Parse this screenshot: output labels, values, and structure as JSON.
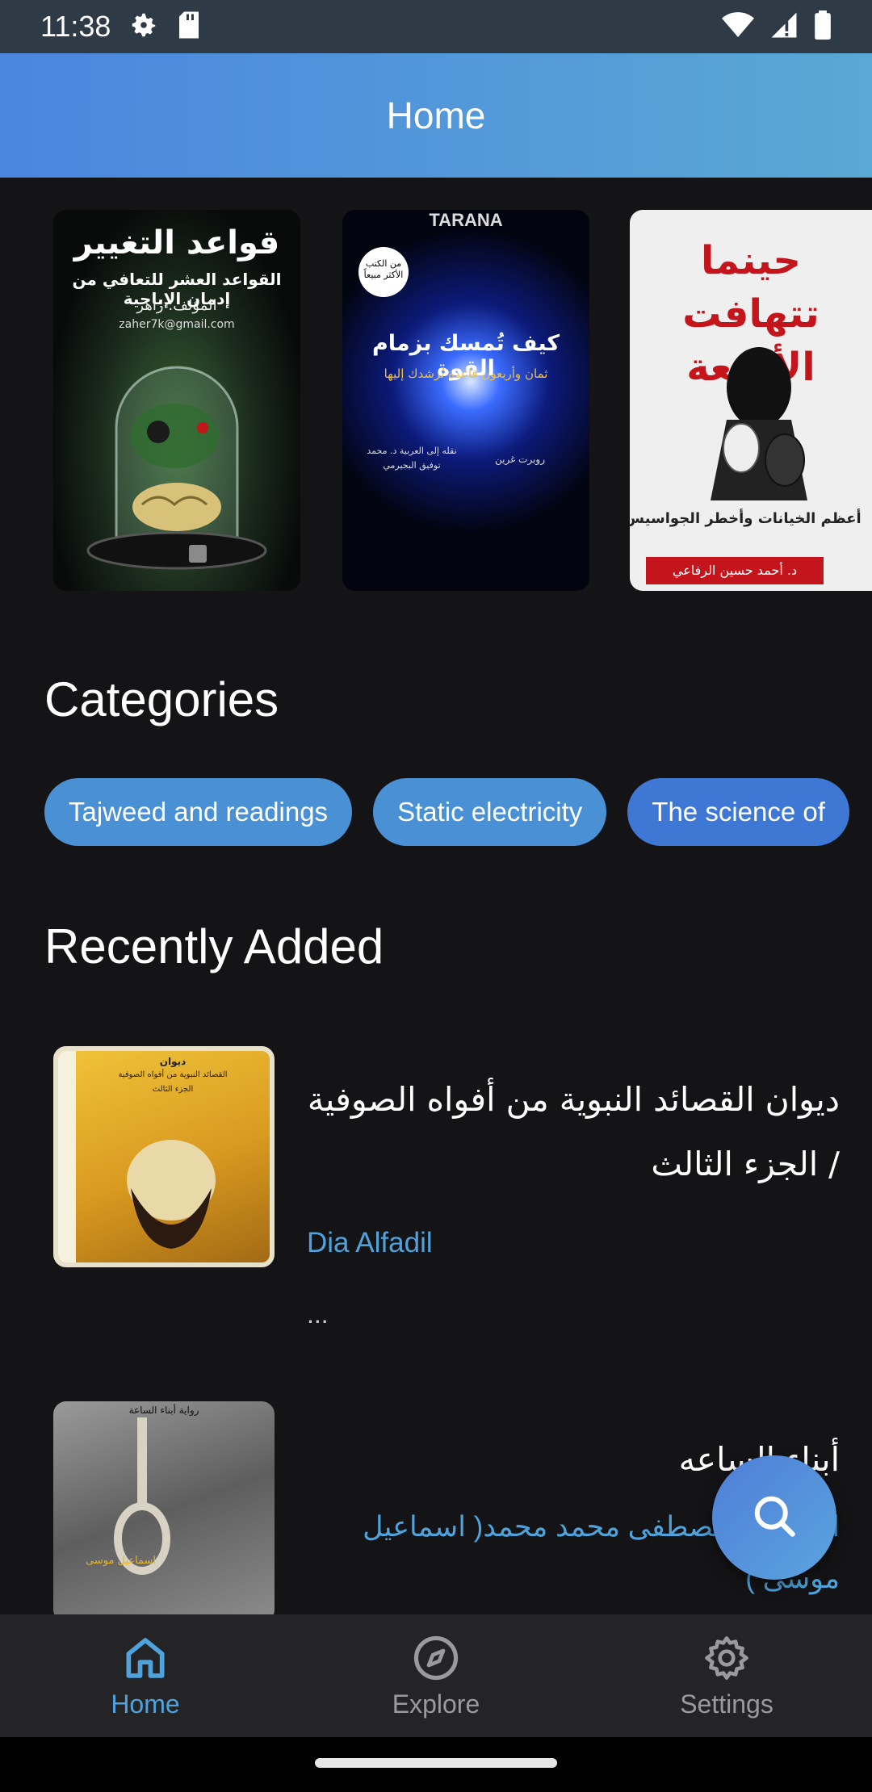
{
  "status_bar": {
    "time": "11:38"
  },
  "app_bar": {
    "title": "Home"
  },
  "featured": {
    "books": [
      {
        "title": "قواعد التغيير",
        "subtitle": "القواعد العشر للتعافي من إدمان الإباحية",
        "author_line": "المؤلف: زاهر",
        "email": "zaher7k@gmail.com"
      },
      {
        "publisher": "TARANA",
        "badge": "من الكتب الأكثر مبيعاً",
        "title": "كيف تُمسك بزمام القوة",
        "subtitle": "ثمان وأربعون قاعدة تُرشدك إليها",
        "translator": "نقله إلى العربية د. محمد توفيق البجيرمي",
        "author": "روبرت غرين"
      },
      {
        "title": "حينما تتهافت الأقنعة",
        "subtitle": "أعظم الخيانات وأخطر الجواسيس",
        "author": "د. أحمد حسين الرفاعي"
      }
    ]
  },
  "categories": {
    "title": "Categories",
    "items": [
      "Tajweed and readings",
      "Static electricity",
      "The science of"
    ]
  },
  "recently_added": {
    "title": "Recently Added",
    "items": [
      {
        "title": "ديوان القصائد النبوية من أفواه الصوفية / الجزء الثالث",
        "author": "Dia Alfadil",
        "description": "...",
        "cover_heading": "ديوان",
        "cover_subtitle": "القصائد النبوية من أفواه الصوفية",
        "cover_part": "الجزء الثالث"
      },
      {
        "title": "أبناء الساعه",
        "author": "اسماعيل مصطفى محمد محمد( اسماعيل موسى )",
        "cover_heading": "رواية أبناء الساعة",
        "cover_author": "اسماعيل موسى"
      }
    ]
  },
  "bottom_nav": {
    "items": [
      {
        "label": "Home",
        "icon": "home-icon",
        "active": true
      },
      {
        "label": "Explore",
        "icon": "compass-icon",
        "active": false
      },
      {
        "label": "Settings",
        "icon": "gear-icon",
        "active": false
      }
    ]
  },
  "colors": {
    "accent": "#4ea3dc",
    "chip": "#4a90d4",
    "background": "#141416",
    "nav_bg": "#242427"
  }
}
